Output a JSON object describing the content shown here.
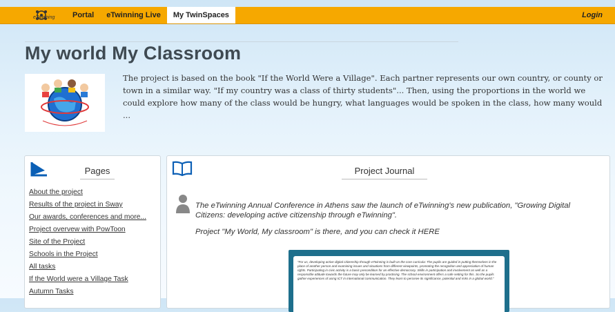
{
  "nav": {
    "logo_text": "eTwinning",
    "items": [
      "Portal",
      "eTwinning Live",
      "My TwinSpaces"
    ],
    "active_index": 2,
    "login_label": "Login"
  },
  "project": {
    "title": "My world My Classroom",
    "logo_caption": "MY WORLD MY CLASSROOM",
    "description": "The project is based on the book \"If the World Were a Village\". Each partner represents our own country, or county or town in a similar way. \"If my country was a class of thirty students\"... Then, using the proportions in the world we could explore how many of the class would be hungry, what languages would be spoken in the class, how many would ..."
  },
  "pages": {
    "heading": "Pages",
    "links": [
      "About the project",
      "Results of the project in Sway",
      "Our awards, conferences and more...",
      "Project overvew with PowToon",
      "Site of the Project",
      "Schools in the Project",
      "All tasks",
      "If the World were a Village Task",
      "Autumn Tasks"
    ]
  },
  "journal": {
    "heading": "Project Journal",
    "post_text": "The eTwinning Annual Conference in Athens saw the launch of eTwinning's new publication, \"Growing Digital Citizens: developing active citizenship through eTwinning\".",
    "post_text2": "Project \"My World, My classroom\" is there, and you can check it HERE",
    "image_text": "\"For us, developing active digital citizenship through eTwinning is built on the core curricula: The pupils are guided in putting themselves in the place of another person and examining issues and situations from different viewpoints, promoting the recognition and appreciation of human rights. Participating in civic activity is a basic precondition for an effective democracy. Skills in participation and involvement as well as a responsible attitude towards the future may only be learned by practising. The school environment offers a safe setting for this. So the pupils gather experiences of using ICT in international communication. They learn to perceive its significance, potential and risks in a global world.\""
  }
}
